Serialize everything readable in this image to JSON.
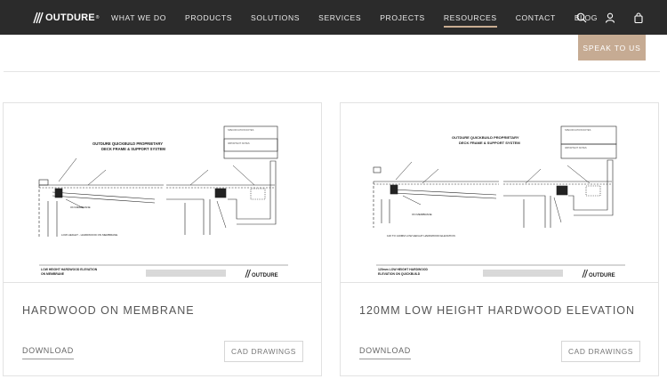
{
  "brand": {
    "name": "OUTDURE"
  },
  "nav": {
    "items": [
      {
        "label": "WHAT WE DO"
      },
      {
        "label": "PRODUCTS"
      },
      {
        "label": "SOLUTIONS"
      },
      {
        "label": "SERVICES"
      },
      {
        "label": "PROJECTS"
      },
      {
        "label": "RESOURCES",
        "active": true
      },
      {
        "label": "CONTACT"
      },
      {
        "label": "BLOG"
      }
    ],
    "icons": [
      "search-icon",
      "user-icon",
      "bag-icon"
    ]
  },
  "cta": {
    "label": "SPEAK TO US"
  },
  "colors": {
    "nav_bg": "#2b2b2b",
    "accent": "#c6ab93",
    "border": "#e2e2e2"
  },
  "cards": [
    {
      "title": "HARDWOOD ON MEMBRANE",
      "download_label": "DOWNLOAD",
      "cad_label": "CAD DRAWINGS",
      "drawing": {
        "system_title_1": "OUTDURE QUICKBUILD PROPRIETARY",
        "system_title_2": "DECK FRAME & SUPPORT SYSTEM",
        "footer_title_1": "LOW HEIGHT HARDWOOD ELEVATION",
        "footer_title_2": "ON MEMBRANE",
        "section_label": "LOW HEIGHT - HARDWOOD ON MEMBRANE",
        "membrane_label": "ON MEMBRANE",
        "footer_brand": "OUTDURE"
      }
    },
    {
      "title": "120MM LOW HEIGHT HARDWOOD ELEVATION",
      "download_label": "DOWNLOAD",
      "cad_label": "CAD DRAWINGS",
      "drawing": {
        "system_title_1": "OUTDURE QUICKBUILD PROPRIETARY",
        "system_title_2": "DECK FRAME & SUPPORT SYSTEM",
        "footer_title_1": "120mm LOW HEIGHT HARDWOOD",
        "footer_title_2": "ELEVATION ON QUICKBUILD",
        "section_label": "120 TO 140MM LOW HEIGHT HARDWOOD ELEVATION",
        "membrane_label": "ON MEMBRANE",
        "footer_brand": "OUTDURE"
      }
    }
  ]
}
